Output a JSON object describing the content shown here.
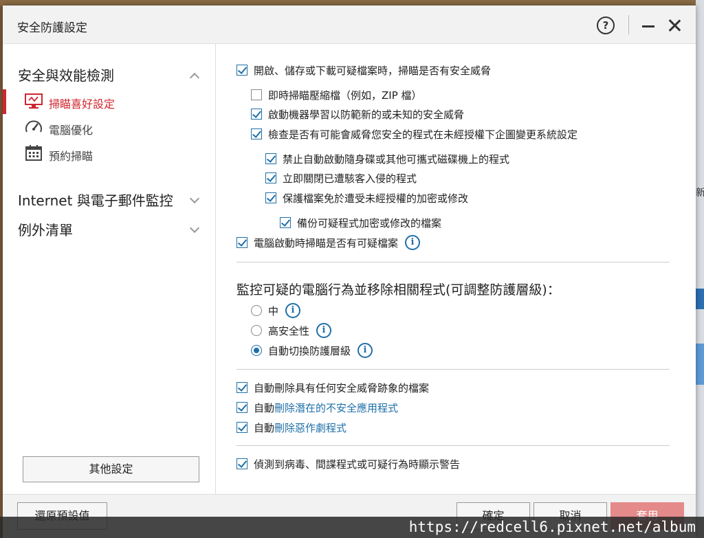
{
  "window": {
    "title": "安全防護設定",
    "help_label": "?"
  },
  "sidebar": {
    "sections": [
      {
        "label": "安全與效能檢測"
      },
      {
        "label": "Internet 與電子郵件監控"
      },
      {
        "label": "例外清單"
      }
    ],
    "items": [
      {
        "label": "掃瞄喜好設定",
        "icon": "monitor-scan-icon"
      },
      {
        "label": "電腦優化",
        "icon": "speedometer-icon"
      },
      {
        "label": "預約掃瞄",
        "icon": "calendar-icon"
      }
    ],
    "other_button": "其他設定"
  },
  "options": {
    "o1": "開啟、儲存或下載可疑檔案時，掃瞄是否有安全威脅",
    "o2": "即時掃瞄壓縮檔（例如，ZIP 檔）",
    "o3": "啟動機器學習以防範新的或未知的安全威脅",
    "o4": "檢查是否有可能會威脅您安全的程式在未經授權下企圖變更系統設定",
    "o5": "禁止自動啟動隨身碟或其他可攜式磁碟機上的程式",
    "o6": "立即關閉已遭駭客入侵的程式",
    "o7": "保護檔案免於遭受未經授權的加密或修改",
    "o8": "備份可疑程式加密或修改的檔案",
    "o9": "電腦啟動時掃瞄是否有可疑檔案"
  },
  "behavior": {
    "heading": "監控可疑的電腦行為並移除相關程式(可調整防護層級)：",
    "levels": [
      "中",
      "高安全性",
      "自動切換防護層級"
    ]
  },
  "removal": {
    "r1": "自動刪除具有任何安全威脅跡象的檔案",
    "r2_prefix": "自動",
    "r2_link": "刪除潛在的不安全應用程式",
    "r3_prefix": "自動",
    "r3_link": "刪除惡作劇程式",
    "r4": "偵測到病毒、間諜程式或可疑行為時顯示警告"
  },
  "footer": {
    "restore": "還原預設值",
    "ok": "確定",
    "cancel": "取消",
    "apply": "套用"
  },
  "watermark": "https://redcell6.pixnet.net/album",
  "background_text": "新",
  "colors": {
    "accent": "#1e6fa8",
    "active": "#d0262f"
  }
}
